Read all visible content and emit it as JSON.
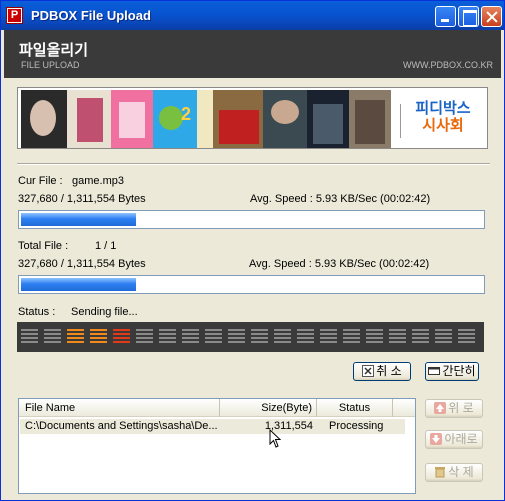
{
  "window": {
    "title": "PDBOX File Upload"
  },
  "header": {
    "title": "파일올리기",
    "subtitle": "FILE UPLOAD",
    "url": "WWW.PDBOX.CO.KR"
  },
  "banner": {
    "line1": "피디박스",
    "line2": "시사회",
    "colors": {
      "line1": "#1a64c8",
      "line2": "#e8680a"
    }
  },
  "current_file": {
    "label": "Cur File :",
    "name": "game.mp3",
    "bytes": "327,680 / 1,311,554 Bytes",
    "speed": "Avg. Speed : 5.93 KB/Sec (00:02:42)",
    "progress_fraction": 0.2498
  },
  "total_file": {
    "label": "Total File :",
    "count": "1 / 1",
    "bytes": "327,680 / 1,311,554 Bytes",
    "speed": "Avg. Speed : 5.93 KB/Sec (00:02:42)",
    "progress_fraction": 0.2498
  },
  "status": {
    "label": "Status :",
    "text": "Sending file...",
    "segments": [
      "gray",
      "gray",
      "orange",
      "orange",
      "red",
      "gray",
      "gray",
      "gray",
      "gray",
      "gray",
      "gray",
      "gray",
      "gray",
      "gray",
      "gray",
      "gray",
      "gray",
      "gray",
      "gray",
      "gray"
    ]
  },
  "buttons": {
    "cancel": "취 소",
    "simple": "간단히",
    "up": "위 로",
    "down": "아래로",
    "delete": "삭 제"
  },
  "file_list": {
    "columns": [
      "File Name",
      "Size(Byte)",
      "Status"
    ],
    "rows": [
      {
        "name": "C:\\Documents and Settings\\sasha\\De...",
        "size": "1,311,554",
        "status": "Processing"
      }
    ]
  },
  "icons": [
    "app-icon",
    "minimize-icon",
    "maximize-icon",
    "close-icon",
    "cancel-x-icon",
    "window-simple-icon",
    "arrow-up-icon",
    "arrow-down-icon",
    "trash-icon",
    "mouse-cursor-icon"
  ]
}
